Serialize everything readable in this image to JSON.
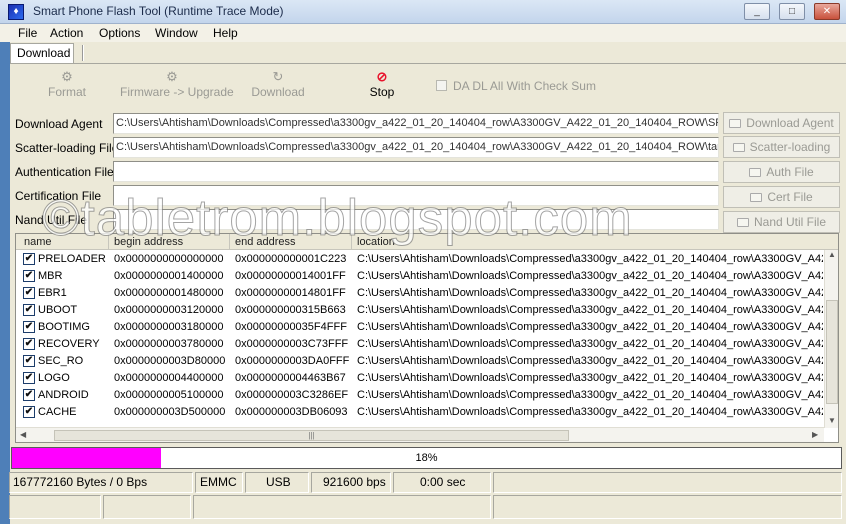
{
  "window": {
    "title": "Smart Phone Flash Tool (Runtime Trace Mode)",
    "minimize": "_",
    "maximize": "□",
    "close": "✕"
  },
  "menu": [
    "File",
    "Action",
    "Options",
    "Window",
    "Help"
  ],
  "tabs": [
    {
      "label": "Download"
    }
  ],
  "toolbar": {
    "format": {
      "label": "Format",
      "icon": "format-icon"
    },
    "firmware_upgrade": {
      "label": "Firmware -> Upgrade",
      "icon": "upgrade-icon"
    },
    "download": {
      "label": "Download",
      "icon": "download-icon"
    },
    "stop": {
      "label": "Stop",
      "icon": "stop-icon"
    },
    "checksum": {
      "label": "DA DL All With Check Sum",
      "checked": false
    }
  },
  "files": {
    "download_agent": {
      "label": "Download Agent",
      "value": "C:\\Users\\Ahtisham\\Downloads\\Compressed\\a3300gv_a422_01_20_140404_row\\A3300GV_A422_01_20_140404_ROW\\SP"
    },
    "scatter_loading": {
      "label": "Scatter-loading File",
      "value": "C:\\Users\\Ahtisham\\Downloads\\Compressed\\a3300gv_a422_01_20_140404_row\\A3300GV_A422_01_20_140404_ROW\\targ"
    },
    "authentication": {
      "label": "Authentication File",
      "value": ""
    },
    "certification": {
      "label": "Certification File",
      "value": ""
    },
    "nand_util": {
      "label": "Nand Util File",
      "value": ""
    }
  },
  "file_buttons": {
    "download_agent": "Download Agent",
    "scatter_loading": "Scatter-loading",
    "auth_file": "Auth File",
    "cert_file": "Cert File",
    "nand_util_file": "Nand Util File"
  },
  "table": {
    "columns": [
      "name",
      "begin address",
      "end address",
      "location"
    ],
    "rows": [
      {
        "checked": true,
        "name": "PRELOADER",
        "begin": "0x0000000000000000",
        "end": "0x000000000001C223",
        "location": "C:\\Users\\Ahtisham\\Downloads\\Compressed\\a3300gv_a422_01_20_140404_row\\A3300GV_A42"
      },
      {
        "checked": true,
        "name": "MBR",
        "begin": "0x0000000001400000",
        "end": "0x00000000014001FF",
        "location": "C:\\Users\\Ahtisham\\Downloads\\Compressed\\a3300gv_a422_01_20_140404_row\\A3300GV_A42"
      },
      {
        "checked": true,
        "name": "EBR1",
        "begin": "0x0000000001480000",
        "end": "0x00000000014801FF",
        "location": "C:\\Users\\Ahtisham\\Downloads\\Compressed\\a3300gv_a422_01_20_140404_row\\A3300GV_A42"
      },
      {
        "checked": true,
        "name": "UBOOT",
        "begin": "0x0000000003120000",
        "end": "0x000000000315B663",
        "location": "C:\\Users\\Ahtisham\\Downloads\\Compressed\\a3300gv_a422_01_20_140404_row\\A3300GV_A42"
      },
      {
        "checked": true,
        "name": "BOOTIMG",
        "begin": "0x0000000003180000",
        "end": "0x00000000035F4FFF",
        "location": "C:\\Users\\Ahtisham\\Downloads\\Compressed\\a3300gv_a422_01_20_140404_row\\A3300GV_A42"
      },
      {
        "checked": true,
        "name": "RECOVERY",
        "begin": "0x0000000003780000",
        "end": "0x0000000003C73FFF",
        "location": "C:\\Users\\Ahtisham\\Downloads\\Compressed\\a3300gv_a422_01_20_140404_row\\A3300GV_A42"
      },
      {
        "checked": true,
        "name": "SEC_RO",
        "begin": "0x0000000003D80000",
        "end": "0x0000000003DA0FFF",
        "location": "C:\\Users\\Ahtisham\\Downloads\\Compressed\\a3300gv_a422_01_20_140404_row\\A3300GV_A42"
      },
      {
        "checked": true,
        "name": "LOGO",
        "begin": "0x0000000004400000",
        "end": "0x0000000004463B67",
        "location": "C:\\Users\\Ahtisham\\Downloads\\Compressed\\a3300gv_a422_01_20_140404_row\\A3300GV_A42"
      },
      {
        "checked": true,
        "name": "ANDROID",
        "begin": "0x0000000005100000",
        "end": "0x000000003C3286EF",
        "location": "C:\\Users\\Ahtisham\\Downloads\\Compressed\\a3300gv_a422_01_20_140404_row\\A3300GV_A42"
      },
      {
        "checked": true,
        "name": "CACHE",
        "begin": "0x000000003D500000",
        "end": "0x000000003DB06093",
        "location": "C:\\Users\\Ahtisham\\Downloads\\Compressed\\a3300gv_a422_01_20_140404_row\\A3300GV_A42"
      }
    ]
  },
  "progress": {
    "percent": 18,
    "label": "18%",
    "color": "#ff00ff"
  },
  "status": {
    "bytes": "167772160 Bytes / 0 Bps",
    "storage": "EMMC",
    "port": "USB",
    "baud": "921600 bps",
    "time": "0:00 sec"
  },
  "watermark": "©tabletrom.blogspot.com"
}
